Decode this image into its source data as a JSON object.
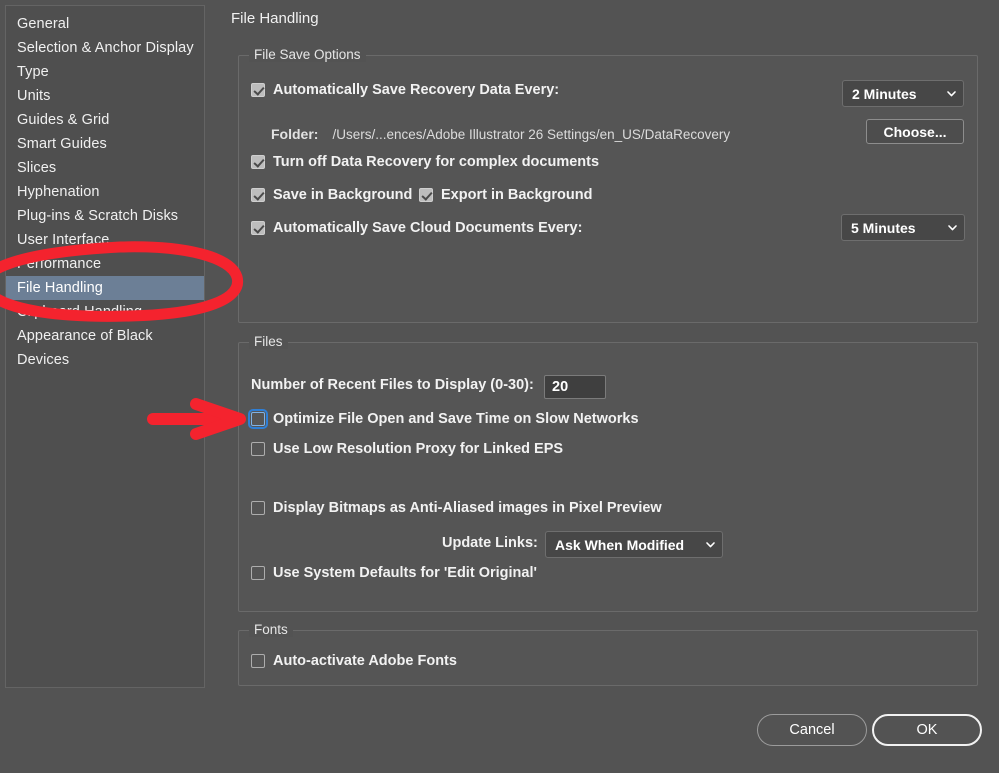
{
  "window": {
    "pane_title": "File Handling"
  },
  "sidebar": {
    "items": [
      {
        "label": "General",
        "selected": false
      },
      {
        "label": "Selection & Anchor Display",
        "selected": false
      },
      {
        "label": "Type",
        "selected": false
      },
      {
        "label": "Units",
        "selected": false
      },
      {
        "label": "Guides & Grid",
        "selected": false
      },
      {
        "label": "Smart Guides",
        "selected": false
      },
      {
        "label": "Slices",
        "selected": false
      },
      {
        "label": "Hyphenation",
        "selected": false
      },
      {
        "label": "Plug-ins & Scratch Disks",
        "selected": false
      },
      {
        "label": "User Interface",
        "selected": false
      },
      {
        "label": "Performance",
        "selected": false
      },
      {
        "label": "File Handling",
        "selected": true
      },
      {
        "label": "Clipboard Handling",
        "selected": false
      },
      {
        "label": "Appearance of Black",
        "selected": false
      },
      {
        "label": "Devices",
        "selected": false
      }
    ]
  },
  "file_save_options": {
    "legend": "File Save Options",
    "auto_save_recovery_label": "Automatically Save Recovery Data Every:",
    "auto_save_recovery_checked": true,
    "recovery_interval_value": "2 Minutes",
    "folder_label": "Folder:",
    "folder_path": "/Users/...ences/Adobe Illustrator 26 Settings/en_US/DataRecovery",
    "choose_button": "Choose...",
    "turn_off_recovery_label": "Turn off Data Recovery for complex documents",
    "turn_off_recovery_checked": true,
    "save_in_background_label": "Save in Background",
    "save_in_background_checked": true,
    "export_in_background_label": "Export in Background",
    "export_in_background_checked": true,
    "auto_save_cloud_label": "Automatically Save Cloud Documents Every:",
    "auto_save_cloud_checked": true,
    "cloud_interval_value": "5 Minutes"
  },
  "files": {
    "legend": "Files",
    "recent_files_label": "Number of Recent Files to Display (0-30):",
    "recent_files_value": "20",
    "optimize_label": "Optimize File Open and Save Time on Slow Networks",
    "optimize_checked": false,
    "optimize_focused": true,
    "low_res_proxy_label": "Use Low Resolution Proxy for Linked EPS",
    "low_res_proxy_checked": false,
    "display_bitmaps_label": "Display Bitmaps as Anti-Aliased images in Pixel Preview",
    "display_bitmaps_checked": false,
    "update_links_label": "Update Links:",
    "update_links_value": "Ask When Modified",
    "system_defaults_label": "Use System Defaults for 'Edit Original'",
    "system_defaults_checked": false
  },
  "fonts": {
    "legend": "Fonts",
    "auto_activate_label": "Auto-activate Adobe Fonts",
    "auto_activate_checked": false
  },
  "footer": {
    "cancel_label": "Cancel",
    "ok_label": "OK"
  },
  "annotations": {
    "oval_target": "File Handling",
    "arrow_target": "Optimize File Open and Save Time on Slow Networks",
    "color": "#f4232e"
  },
  "colors": {
    "background": "#535353",
    "selection": "#6c7f96",
    "focus_ring": "#2f7fd6",
    "annotation_red": "#f4232e"
  }
}
